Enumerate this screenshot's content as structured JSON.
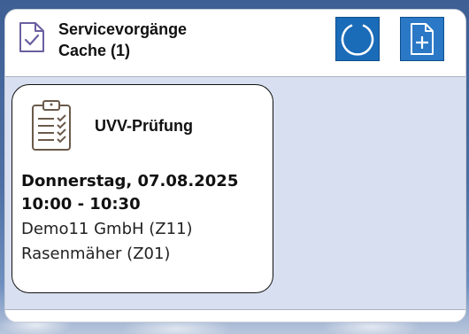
{
  "header": {
    "title_line1": "Servicevorgänge",
    "title_line2": "Cache (1)",
    "icons": {
      "title": "document-check-icon",
      "refresh": "refresh-icon",
      "new": "new-document-icon"
    }
  },
  "colors": {
    "accent": "#1a6bb8",
    "content_bg": "#d8dff0",
    "icon_stroke": "#6b5fa0"
  },
  "cards": [
    {
      "title": "UVV-Prüfung",
      "date": "Donnerstag, 07.08.2025",
      "time": "10:00 - 10:30",
      "customer": "Demo11 GmbH (Z11)",
      "object": "Rasenmäher (Z01)",
      "icon": "clipboard-checklist-icon"
    }
  ]
}
